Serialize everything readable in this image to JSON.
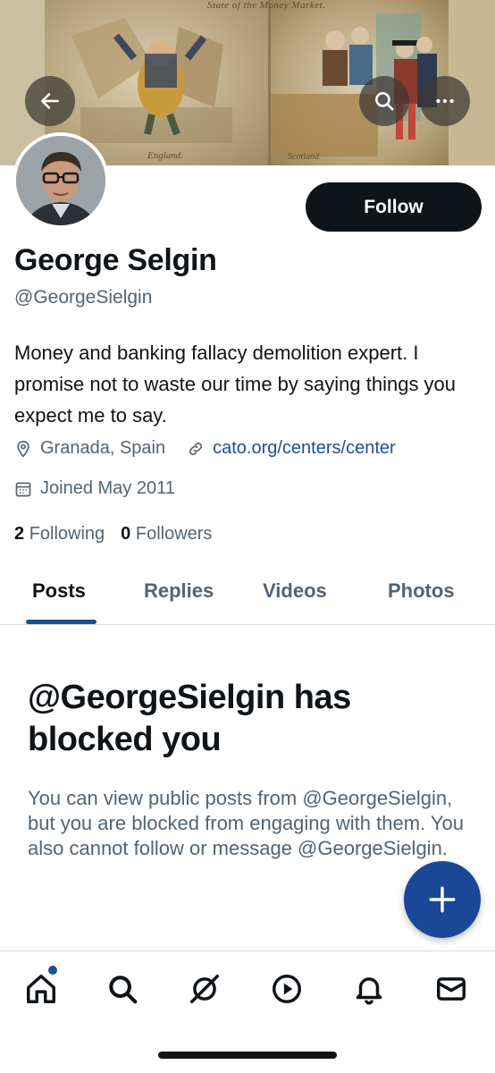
{
  "banner": {
    "caption_top": "State of the   Money Market.",
    "caption_left": "England.",
    "caption_right": "Scotland"
  },
  "header": {
    "back_icon": "arrow-left-icon",
    "search_icon": "search-icon",
    "more_icon": "more-horizontal-icon"
  },
  "profile": {
    "follow_label": "Follow",
    "name": "George Selgin",
    "handle": "@GeorgeSielgin",
    "bio": "Money and banking fallacy demolition expert. I promise not to waste our time by saying things you expect me to say.",
    "location": "Granada, Spain",
    "website": "cato.org/centers/center",
    "joined": "Joined May 2011",
    "following_count": "2",
    "following_label": "Following",
    "followers_count": "0",
    "followers_label": "Followers"
  },
  "tabs": [
    {
      "label": "Posts"
    },
    {
      "label": "Replies"
    },
    {
      "label": "Videos"
    },
    {
      "label": "Photos"
    }
  ],
  "blocked": {
    "title": "@GeorgeSielgin has blocked you",
    "body": "You can view public posts from @GeorgeSielgin, but you are blocked from engaging with them. You also cannot follow or message @GeorgeSielgin."
  },
  "colors": {
    "accent": "#1d4f91",
    "fab": "#1b4797",
    "text_primary": "#0f1419",
    "text_secondary": "#536471"
  },
  "bottom_nav": [
    "home-icon",
    "search-icon",
    "grok-icon",
    "video-icon",
    "notifications-icon",
    "messages-icon"
  ]
}
